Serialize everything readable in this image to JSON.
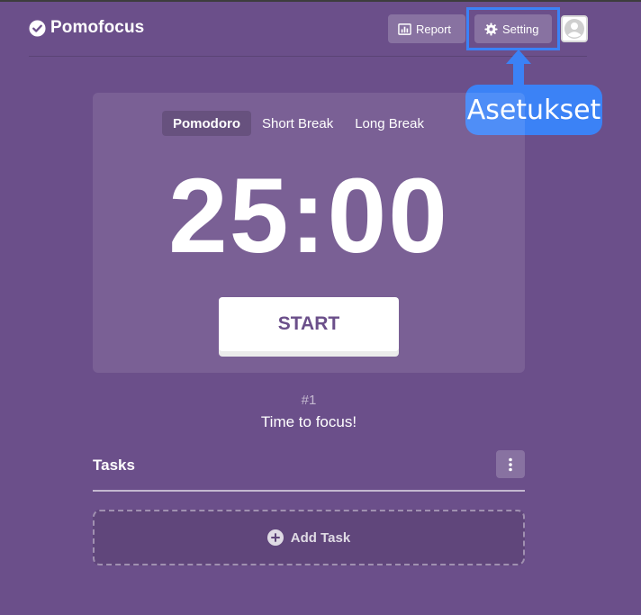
{
  "app": {
    "name": "Pomofocus"
  },
  "header": {
    "report_label": "Report",
    "setting_label": "Setting"
  },
  "annotation": {
    "label": "Asetukset"
  },
  "timer": {
    "modes": [
      "Pomodoro",
      "Short Break",
      "Long Break"
    ],
    "active_mode": "Pomodoro",
    "time": "25:00",
    "start_label": "START"
  },
  "session": {
    "counter": "#1",
    "message": "Time to focus!"
  },
  "tasks": {
    "title": "Tasks",
    "add_label": "Add Task"
  },
  "colors": {
    "background": "#6b4f8a",
    "annotation": "#3b82f6"
  },
  "icons": {
    "brand": "check-circle-icon",
    "report": "bar-chart-icon",
    "setting": "gear-icon",
    "avatar": "user-icon",
    "menu": "kebab-menu-icon",
    "add": "plus-circle-icon",
    "arrow": "arrow-up-icon"
  }
}
